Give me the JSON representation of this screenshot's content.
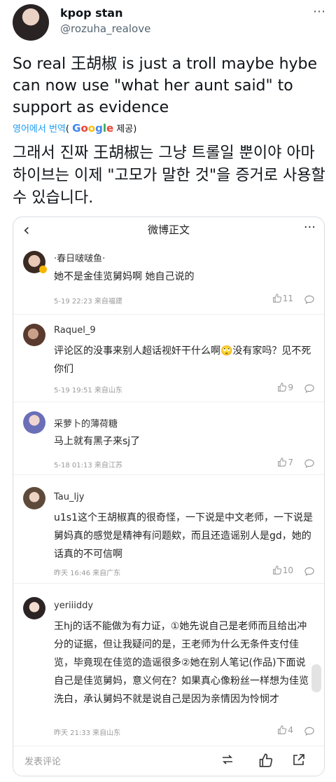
{
  "tweet": {
    "author_name": "kpop stan",
    "author_handle": "@rozuha_realove",
    "text": "So real 王胡椒 is just a troll maybe hybe can now use \"what her aunt said\" to support as evidence",
    "translate_label": "영어에서 번역",
    "translate_provider_open": "(",
    "translate_provider_close": "제공)",
    "google_letters": [
      "G",
      "o",
      "o",
      "g",
      "l",
      "e"
    ],
    "translated_text": "그래서 진짜 王胡椒는 그냥 트롤일 뿐이야 아마 하이브는 이제 \"고모가 말한 것\"을 증거로 사용할 수 있습니다."
  },
  "weibo": {
    "title": "微博正文",
    "back_icon": "‹",
    "more_icon": "···",
    "comments": [
      {
        "name": "·春日啵啵鱼·",
        "body": "她不是金佳览舅妈啊 她自己说的",
        "meta": "5-19 22:23 来自福建",
        "likes": "11"
      },
      {
        "name": "Raquel_9",
        "body": "评论区的没事来别人超话视奸干什么啊🙄没有家吗？见不死你们",
        "meta": "5-19 19:51 来自山东",
        "likes": "9"
      },
      {
        "name": "采萝卜的薄荷糖",
        "body": "马上就有黑子来sj了",
        "meta": "5-18 01:13 来自江苏",
        "likes": "7"
      },
      {
        "name": "Tau_ljy",
        "body": "u1s1这个王胡椒真的很奇怪，一下说是中文老师，一下说是舅妈真的感觉是精神有问题欸，而且还造谣别人是gd，她的话真的不可信啊",
        "meta": "昨天 16:46 来自广东",
        "likes": "10"
      },
      {
        "name": "yeriiiddy",
        "body": "王hj的话不能做为有力证，①她先说自己是老师而且给出冲分的证据，但让我疑问的是，王老师为什么无条件支付佳览，毕竟现在佳览的造谣很多②她在别人笔记(作品)下面说自己是佳览舅妈，意义何在？如果真心像粉丝一样想为佳览洗白，承认舅妈不就是说自己是因为亲情因为怜悯才",
        "meta": "昨天 21:33 来自山东",
        "likes": "4"
      }
    ],
    "comment_placeholder": "发表评论"
  }
}
